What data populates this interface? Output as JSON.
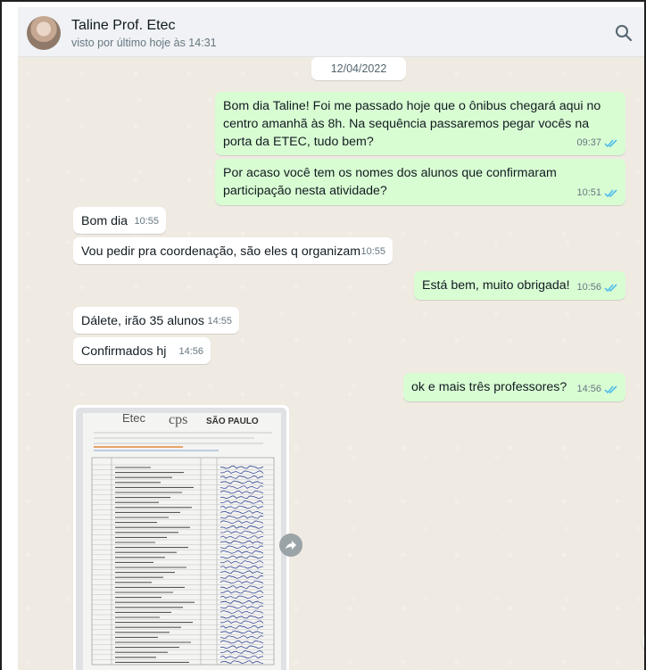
{
  "header": {
    "contact_name": "Taline Prof. Etec",
    "last_seen": "visto por último hoje às 14:31",
    "search_icon": "search-icon"
  },
  "date_chip": "12/04/2022",
  "messages": [
    {
      "direction": "out",
      "text": "Bom dia Taline! Foi me passado hoje que o ônibus chegará aqui no centro amanhã às 8h. Na sequência passaremos pegar vocês na porta da ETEC, tudo bem?",
      "time": "09:37",
      "status": "read"
    },
    {
      "direction": "out",
      "text": "Por acaso você tem os nomes dos alunos que confirmaram participação nesta atividade?",
      "time": "10:51",
      "status": "read"
    },
    {
      "direction": "in",
      "text": "Bom dia",
      "time": "10:55"
    },
    {
      "direction": "in",
      "text": "Vou pedir pra coordenação, são eles q organizam",
      "time": "10:55"
    },
    {
      "direction": "out",
      "text": "Está bem, muito obrigada!",
      "time": "10:56",
      "status": "read"
    },
    {
      "direction": "in",
      "text": "Dálete, irão 35 alunos",
      "time": "14:55"
    },
    {
      "direction": "in",
      "text": "Confirmados hj",
      "time": "14:56"
    },
    {
      "direction": "out",
      "text": "ok e mais três professores?",
      "time": "14:56",
      "status": "read"
    }
  ],
  "image_message": {
    "header_left": "Etec",
    "header_mid": "cps",
    "header_right": "SÃO PAULO"
  },
  "colors": {
    "outgoing_bubble": "#d9fdd3",
    "incoming_bubble": "#ffffff",
    "chat_background": "#efeae2",
    "read_tick": "#53bdeb"
  }
}
